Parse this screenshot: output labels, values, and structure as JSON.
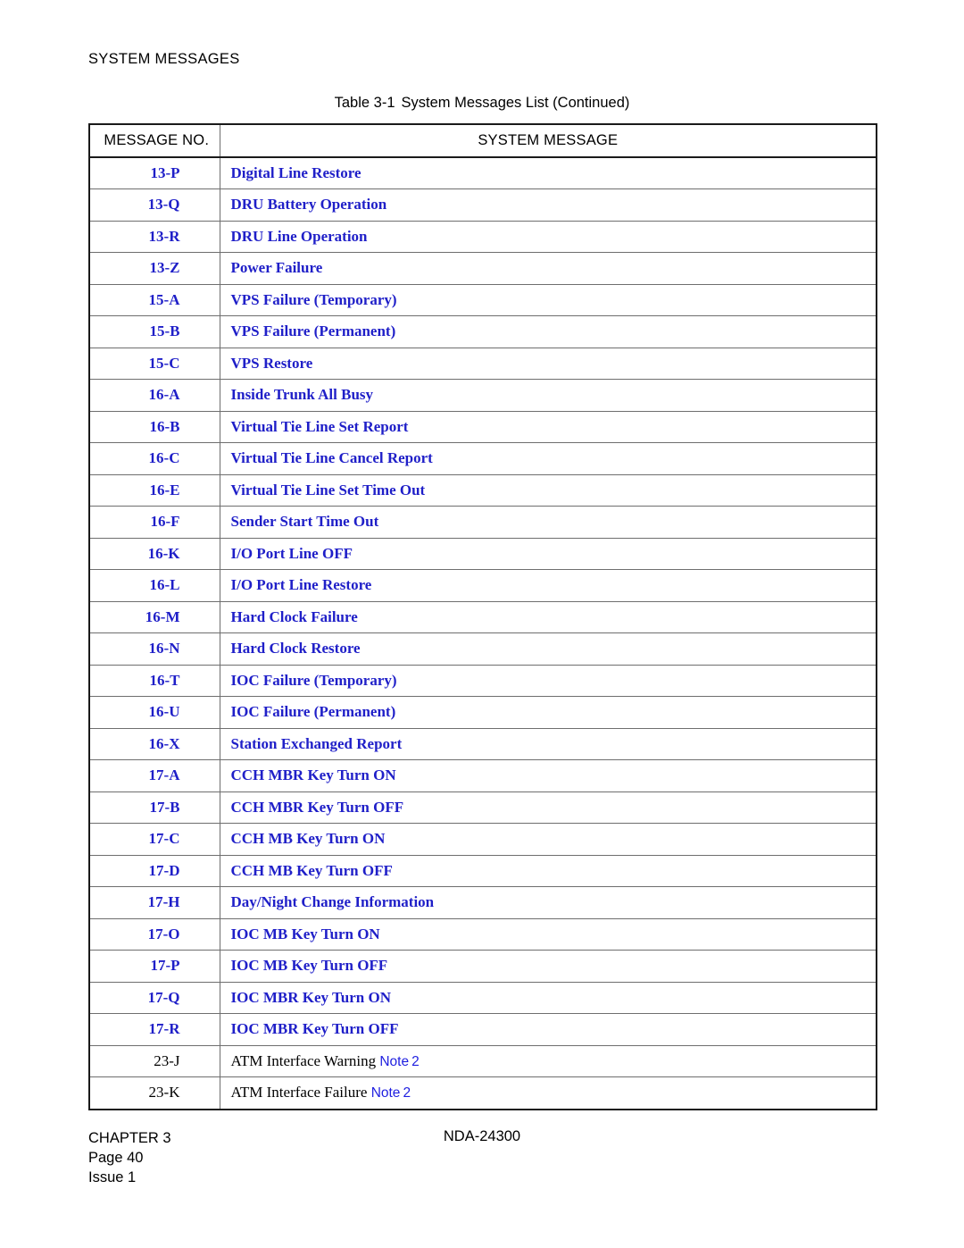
{
  "document": {
    "running_head": "SYSTEM MESSAGES",
    "caption_label": "Table 3-1",
    "caption_title": "System Messages List (Continued)"
  },
  "table": {
    "columns": [
      {
        "key": "message_no",
        "header": "MESSAGE NO."
      },
      {
        "key": "system_message",
        "header": "SYSTEM MESSAGE"
      }
    ],
    "text_color_blue": "#1f1fc8",
    "text_color_black": "#000000",
    "border_color_outer": "#1a1a1a",
    "border_color_inner": "#6e6e6e",
    "rows": [
      {
        "no": "13-P",
        "msg": "Digital Line Restore",
        "style": "blue"
      },
      {
        "no": "13-Q",
        "msg": "DRU Battery Operation",
        "style": "blue"
      },
      {
        "no": "13-R",
        "msg": "DRU Line Operation",
        "style": "blue"
      },
      {
        "no": "13-Z",
        "msg": "Power Failure",
        "style": "blue"
      },
      {
        "no": "15-A",
        "msg": "VPS Failure (Temporary)",
        "style": "blue"
      },
      {
        "no": "15-B",
        "msg": "VPS Failure (Permanent)",
        "style": "blue"
      },
      {
        "no": "15-C",
        "msg": "VPS Restore",
        "style": "blue"
      },
      {
        "no": "16-A",
        "msg": "Inside Trunk All Busy",
        "style": "blue"
      },
      {
        "no": "16-B",
        "msg": "Virtual Tie Line Set Report",
        "style": "blue"
      },
      {
        "no": "16-C",
        "msg": "Virtual Tie Line Cancel Report",
        "style": "blue"
      },
      {
        "no": "16-E",
        "msg": "Virtual Tie Line Set Time Out",
        "style": "blue"
      },
      {
        "no": "16-F",
        "msg": "Sender Start Time Out",
        "style": "blue"
      },
      {
        "no": "16-K",
        "msg": "I/O Port Line OFF",
        "style": "blue"
      },
      {
        "no": "16-L",
        "msg": "I/O Port Line Restore",
        "style": "blue"
      },
      {
        "no": "16-M",
        "msg": "Hard Clock Failure",
        "style": "blue"
      },
      {
        "no": "16-N",
        "msg": "Hard Clock Restore",
        "style": "blue"
      },
      {
        "no": "16-T",
        "msg": "IOC Failure (Temporary)",
        "style": "blue"
      },
      {
        "no": "16-U",
        "msg": "IOC Failure (Permanent)",
        "style": "blue"
      },
      {
        "no": "16-X",
        "msg": "Station Exchanged Report",
        "style": "blue"
      },
      {
        "no": "17-A",
        "msg": "CCH MBR Key Turn ON",
        "style": "blue"
      },
      {
        "no": "17-B",
        "msg": "CCH MBR Key Turn OFF",
        "style": "blue"
      },
      {
        "no": "17-C",
        "msg": "CCH MB Key Turn ON",
        "style": "blue"
      },
      {
        "no": "17-D",
        "msg": "CCH MB Key Turn OFF",
        "style": "blue"
      },
      {
        "no": "17-H",
        "msg": "Day/Night Change Information",
        "style": "blue"
      },
      {
        "no": "17-O",
        "msg": "IOC MB Key Turn ON",
        "style": "blue"
      },
      {
        "no": "17-P",
        "msg": "IOC MB Key Turn OFF",
        "style": "blue"
      },
      {
        "no": "17-Q",
        "msg": "IOC MBR Key Turn ON",
        "style": "blue"
      },
      {
        "no": "17-R",
        "msg": "IOC MBR Key Turn OFF",
        "style": "blue"
      },
      {
        "no": "23-J",
        "msg": "ATM Interface Warning",
        "style": "black",
        "note_label": "Note",
        "note_number": "2"
      },
      {
        "no": "23-K",
        "msg": "ATM Interface Failure",
        "style": "black",
        "note_label": "Note",
        "note_number": "2"
      }
    ]
  },
  "footer": {
    "chapter": "CHAPTER 3",
    "page": "Page 40",
    "issue": "Issue 1",
    "doc_number": "NDA-24300"
  }
}
